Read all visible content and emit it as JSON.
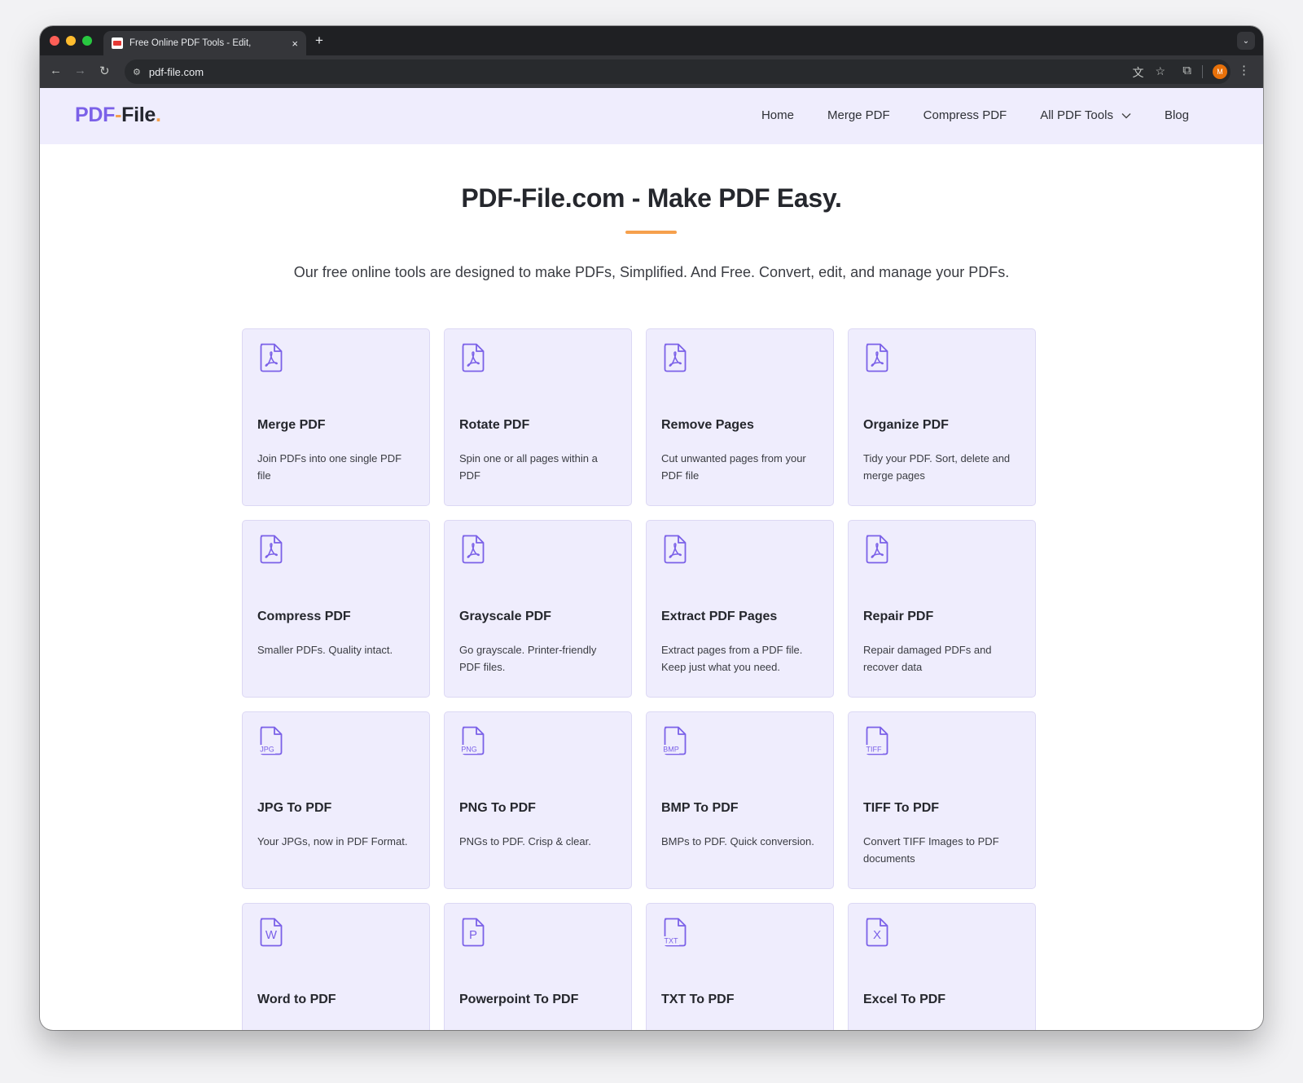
{
  "browser": {
    "tab_title": "Free Online PDF Tools - Edit,",
    "tab_close": "×",
    "new_tab": "+",
    "url": "pdf-file.com",
    "avatar_letter": "M"
  },
  "site": {
    "logo": {
      "part1": "PDF",
      "dash": "-",
      "part2": "File",
      "dot": "."
    },
    "nav": [
      {
        "label": "Home"
      },
      {
        "label": "Merge PDF"
      },
      {
        "label": "Compress PDF"
      },
      {
        "label": "All PDF Tools"
      },
      {
        "label": "Blog"
      }
    ],
    "hero_title": "PDF-File.com - Make PDF Easy.",
    "hero_subtitle": "Our free online tools are designed to make PDFs, Simplified. And Free. Convert, edit, and manage your PDFs."
  },
  "colors": {
    "accent": "#7b61e8",
    "orange": "#f6a04d",
    "card_bg": "#efedfd",
    "header_bg": "#efedfd"
  },
  "tools": [
    {
      "title": "Merge PDF",
      "desc": "Join PDFs into one single PDF file",
      "icon": "pdf-file-icon"
    },
    {
      "title": "Rotate PDF",
      "desc": "Spin one or all pages within a PDF",
      "icon": "pdf-file-icon"
    },
    {
      "title": "Remove Pages",
      "desc": "Cut unwanted pages from your PDF file",
      "icon": "pdf-file-icon"
    },
    {
      "title": "Organize PDF",
      "desc": "Tidy your PDF. Sort, delete and merge pages",
      "icon": "pdf-file-icon"
    },
    {
      "title": "Compress PDF",
      "desc": "Smaller PDFs. Quality intact.",
      "icon": "pdf-file-icon"
    },
    {
      "title": "Grayscale PDF",
      "desc": "Go grayscale. Printer-friendly PDF files.",
      "icon": "pdf-file-icon"
    },
    {
      "title": "Extract PDF Pages",
      "desc": "Extract pages from a PDF file. Keep just what you need.",
      "icon": "pdf-file-icon"
    },
    {
      "title": "Repair PDF",
      "desc": "Repair damaged PDFs and recover data",
      "icon": "pdf-file-icon"
    },
    {
      "title": "JPG To PDF",
      "desc": "Your JPGs, now in PDF Format.",
      "icon": "jpg-file-icon",
      "icon_text": "JPG"
    },
    {
      "title": "PNG To PDF",
      "desc": "PNGs to PDF. Crisp & clear.",
      "icon": "png-file-icon",
      "icon_text": "PNG"
    },
    {
      "title": "BMP To PDF",
      "desc": "BMPs to PDF. Quick conversion.",
      "icon": "bmp-file-icon",
      "icon_text": "BMP"
    },
    {
      "title": "TIFF To PDF",
      "desc": "Convert TIFF Images to PDF documents",
      "icon": "tiff-file-icon",
      "icon_text": "TIFF"
    },
    {
      "title": "Word to PDF",
      "desc": "",
      "icon": "word-file-icon",
      "icon_text": "W"
    },
    {
      "title": "Powerpoint To PDF",
      "desc": "",
      "icon": "powerpoint-file-icon",
      "icon_text": "P"
    },
    {
      "title": "TXT To PDF",
      "desc": "",
      "icon": "txt-file-icon",
      "icon_text": "TXT"
    },
    {
      "title": "Excel To PDF",
      "desc": "",
      "icon": "excel-file-icon",
      "icon_text": "X"
    }
  ]
}
